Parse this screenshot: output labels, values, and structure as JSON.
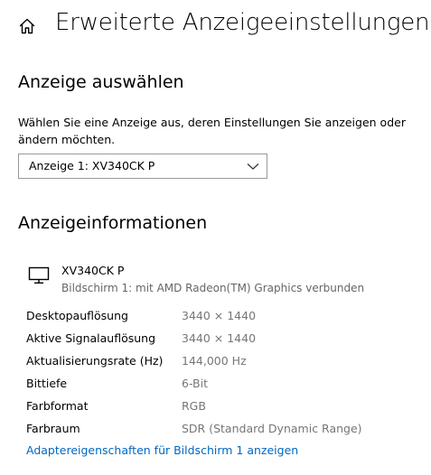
{
  "header": {
    "title": "Erweiterte Anzeigeeinstellungen",
    "home_icon": "home-icon"
  },
  "select_display": {
    "heading": "Anzeige auswählen",
    "description": "Wählen Sie eine Anzeige aus, deren Einstellungen Sie anzeigen oder ändern möchten.",
    "selected": "Anzeige 1: XV340CK P",
    "chevron_icon": "chevron-down-icon"
  },
  "display_info": {
    "heading": "Anzeigeinformationen",
    "monitor_icon": "monitor-icon",
    "monitor_name": "XV340CK P",
    "monitor_subtitle": "Bildschirm 1: mit AMD Radeon(TM) Graphics verbunden",
    "rows": [
      {
        "label": "Desktopauflösung",
        "value": "3440 × 1440"
      },
      {
        "label": "Aktive Signalauflösung",
        "value": "3440 × 1440"
      },
      {
        "label": "Aktualisierungsrate (Hz)",
        "value": "144,000 Hz"
      },
      {
        "label": "Bittiefe",
        "value": "6-Bit"
      },
      {
        "label": "Farbformat",
        "value": "RGB"
      },
      {
        "label": "Farbraum",
        "value": "SDR (Standard Dynamic Range)"
      }
    ],
    "adapter_link": "Adaptereigenschaften für Bildschirm 1 anzeigen"
  },
  "colors": {
    "text": "#000000",
    "secondary_text": "#767676",
    "link": "#0067c0",
    "dropdown_border": "#999999",
    "background": "#ffffff"
  }
}
